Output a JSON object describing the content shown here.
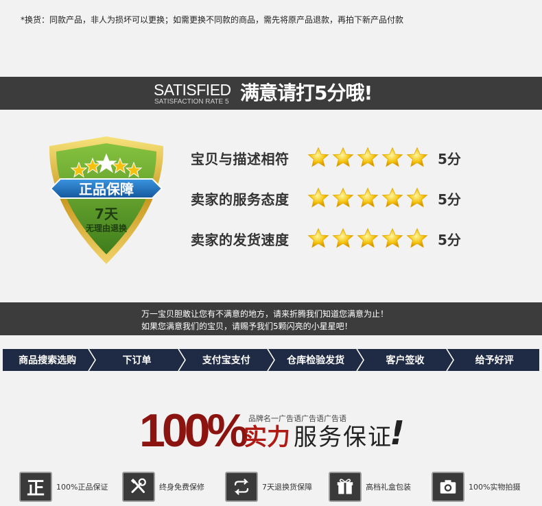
{
  "note": "*换货：同款产品，非人为损坏可以更换；如需更换不同款的商品，需先将原产品退款，再拍下新产品付款",
  "satisfied_bar": {
    "en": "SATISFIED",
    "en_sub": "SATISFACTION RATE 5",
    "cn": "满意请打5分哦!"
  },
  "badge": {
    "title": "正品保障",
    "days": "7天",
    "return": "无理由退换"
  },
  "ratings": [
    {
      "label": "宝贝与描述相符",
      "stars": 5,
      "score": "5分"
    },
    {
      "label": "卖家的服务态度",
      "stars": 5,
      "score": "5分"
    },
    {
      "label": "卖家的发货速度",
      "stars": 5,
      "score": "5分"
    }
  ],
  "message": {
    "line1": "万一宝贝胆敢让您有不满意的地方，请来折腾我们知道您满意为止！",
    "line2": "如果您满意我们的宝贝，请赐予我们5颗闪亮的小星星吧！"
  },
  "steps": [
    "商品搜索选购",
    "下订单",
    "支付宝支付",
    "仓库检验发货",
    "客户签收",
    "给予好评"
  ],
  "slogan": {
    "percent": "100%",
    "brand_line": "品牌名一广告语广告语广告语",
    "red": "实力",
    "black": "服务保证",
    "excl": "!"
  },
  "guarantees": [
    {
      "icon": "zheng-icon",
      "icon_text": "正",
      "label": "100%正品保证"
    },
    {
      "icon": "tools-icon",
      "label": "终身免费保修"
    },
    {
      "icon": "exchange-icon",
      "label": "7天退换货保障"
    },
    {
      "icon": "gift-icon",
      "label": "高档礼盒包装"
    },
    {
      "icon": "camera-icon",
      "label": "100%实物拍摄"
    }
  ],
  "colors": {
    "dark_bar": "#3c3c3c",
    "steps_bar": "#1f2a44",
    "star_gold": "#f4c20d",
    "accent_red": "#b01a14",
    "shield_green": "#5a9a2c",
    "ribbon_blue": "#1d6fb8"
  }
}
